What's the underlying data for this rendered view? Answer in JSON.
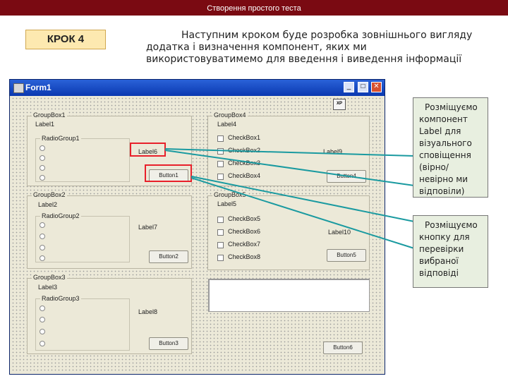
{
  "header": {
    "title": "Створення простого теста"
  },
  "step": {
    "label": "КРОК 4"
  },
  "intro": {
    "text": "Наступним кроком буде розробка зовнішнього вигляду додатка і визначення компонент, яких ми використовуватимемо для введення і виведення інформації"
  },
  "form": {
    "title": "Form1",
    "window_buttons": {
      "minimize": "_",
      "maximize": "□",
      "close": "✕"
    },
    "xp_icon_label": "XP",
    "left_groups": [
      {
        "caption": "GroupBox1",
        "label": "Label1",
        "radio_group": "RadioGroup1",
        "side_label": "Label6",
        "button": "Button1"
      },
      {
        "caption": "GroupBox2",
        "label": "Label2",
        "radio_group": "RadioGroup2",
        "side_label": "Label7",
        "button": "Button2"
      },
      {
        "caption": "GroupBox3",
        "label": "Label3",
        "radio_group": "RadioGroup3",
        "side_label": "Label8",
        "button": "Button3"
      }
    ],
    "right_groups": [
      {
        "caption": "GroupBox4",
        "label": "Label4",
        "checkboxes": [
          "CheckBox1",
          "CheckBox2",
          "CheckBox3",
          "CheckBox4"
        ],
        "side_label": "Label9",
        "button": "Button4"
      },
      {
        "caption": "GroupBox5",
        "label": "Label5",
        "checkboxes": [
          "CheckBox5",
          "CheckBox6",
          "CheckBox7",
          "CheckBox8"
        ],
        "side_label": "Label10",
        "button": "Button5"
      }
    ],
    "bottom_button": "Button6"
  },
  "notes": [
    {
      "lines": [
        "Розміщуємо",
        "компонент",
        "Label для",
        "візуального",
        "сповіщення",
        "(вірно/",
        "невірно ми",
        "відповіли)"
      ]
    },
    {
      "lines": [
        "Розміщуємо",
        "кнопку для",
        "перевірки",
        "вибраної",
        "відповіді"
      ]
    }
  ],
  "colors": {
    "header_bg": "#7a0a12",
    "step_bg": "#fde9b0",
    "note_bg": "#e8efe0",
    "highlight": "#e8202a",
    "connector": "#1a9aa0"
  }
}
